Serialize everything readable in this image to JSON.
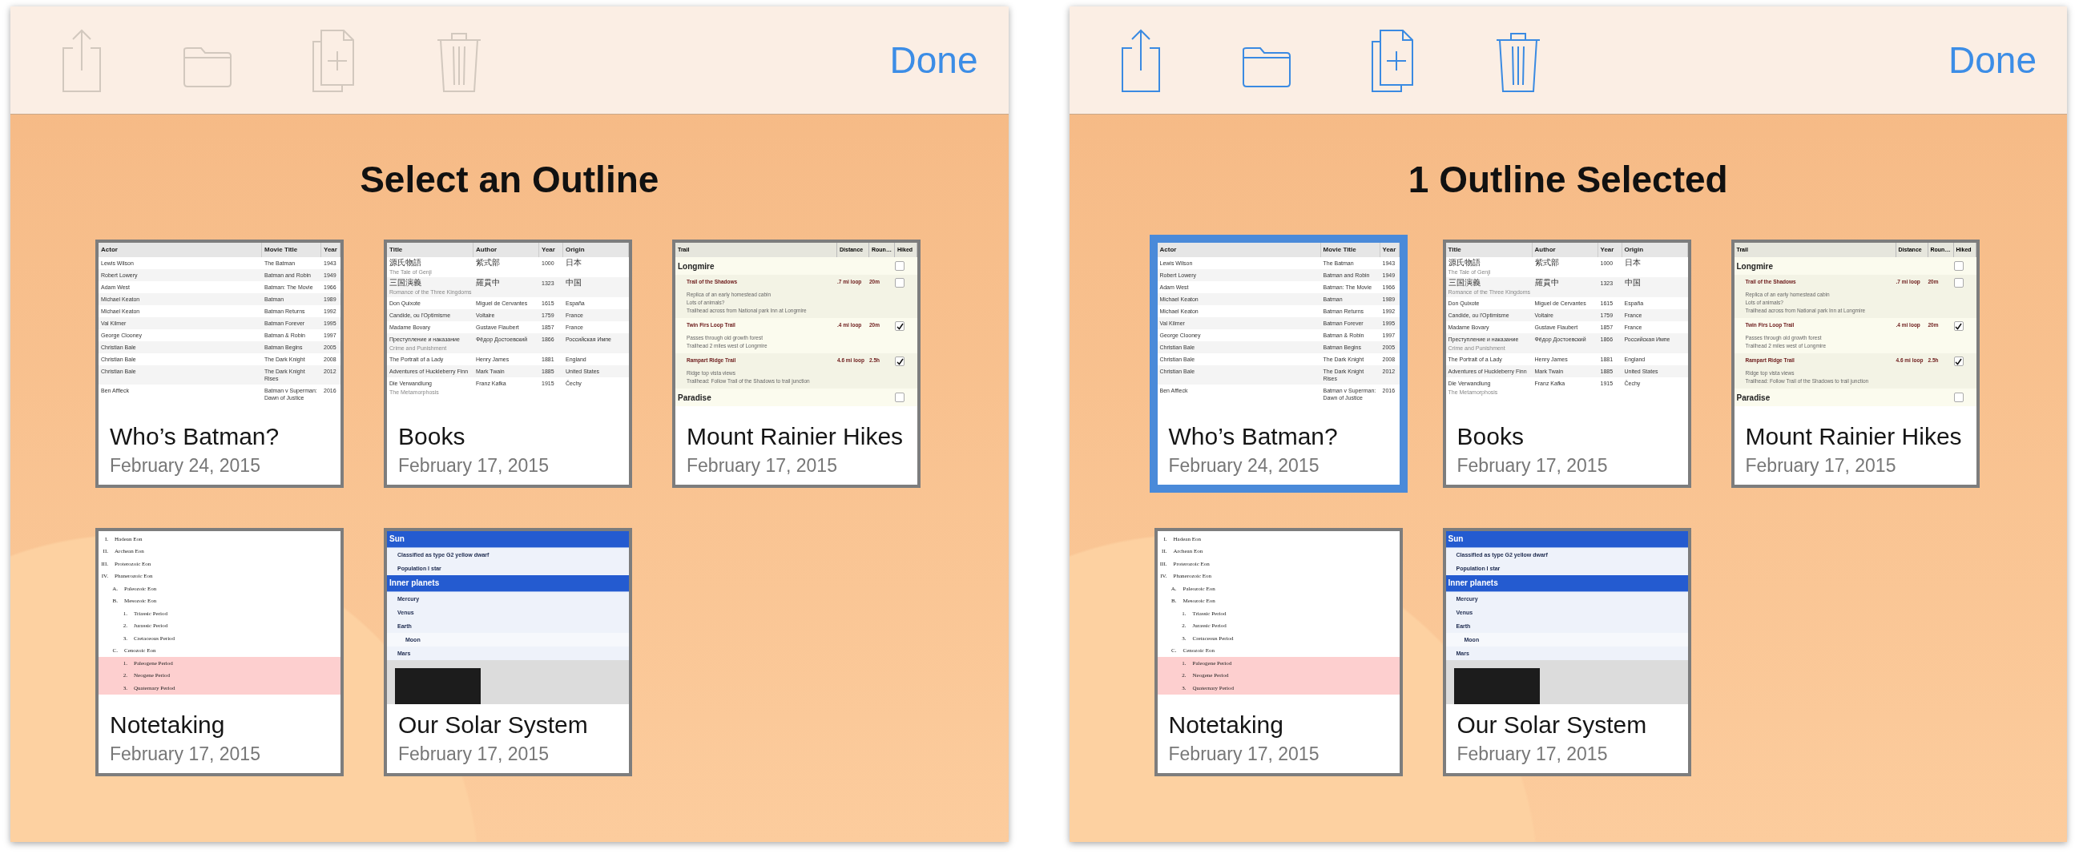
{
  "panels": [
    {
      "toolbar": {
        "disabled": true,
        "done": "Done"
      },
      "title": "Select an Outline",
      "outlines": [
        {
          "name": "Who’s Batman?",
          "date": "February 24, 2015",
          "selected": false,
          "preview": {
            "kind": "table",
            "columns": [
              "Actor",
              "Movie Title",
              "Year"
            ],
            "rows": [
              {
                "cells": [
                  "Lewis Wilson",
                  "The Batman",
                  "1943"
                ]
              },
              {
                "cells": [
                  "Robert Lowery",
                  "Batman and Robin",
                  "1949"
                ]
              },
              {
                "cells": [
                  "Adam West",
                  "Batman: The Movie",
                  "1966"
                ]
              },
              {
                "cells": [
                  "Michael Keaton",
                  "Batman",
                  "1989"
                ]
              },
              {
                "cells": [
                  "Michael Keaton",
                  "Batman Returns",
                  "1992"
                ]
              },
              {
                "cells": [
                  "Val Kilmer",
                  "Batman Forever",
                  "1995"
                ]
              },
              {
                "cells": [
                  "George Clooney",
                  "Batman & Robin",
                  "1997"
                ]
              },
              {
                "cells": [
                  "Christian Bale",
                  "Batman Begins",
                  "2005"
                ]
              },
              {
                "cells": [
                  "Christian Bale",
                  "The Dark Knight",
                  "2008"
                ]
              },
              {
                "cells": [
                  "Christian Bale",
                  "The Dark Knight Rises",
                  "2012"
                ]
              },
              {
                "cells": [
                  "Ben Affleck",
                  "Batman v Superman: Dawn of Justice",
                  "2016"
                ]
              }
            ]
          }
        },
        {
          "name": "Books",
          "date": "February 17, 2015",
          "selected": false,
          "preview": {
            "kind": "table",
            "columns": [
              "Title",
              "Author",
              "Year",
              "Origin"
            ],
            "rows": [
              {
                "cells": [
                  "源氏物語",
                  "紫式部",
                  "1000",
                  "日本"
                ],
                "note": "The Tale of Genji"
              },
              {
                "cells": [
                  "三国演義",
                  "羅貫中",
                  "1323",
                  "中国"
                ],
                "note": "Romance of the Three Kingdoms"
              },
              {
                "cells": [
                  "Don Quixote",
                  "Miguel de Cervantes",
                  "1615",
                  "España"
                ]
              },
              {
                "cells": [
                  "Candide, ou l'Optimisme",
                  "Voltaire",
                  "1759",
                  "France"
                ]
              },
              {
                "cells": [
                  "Madame Bovary",
                  "Gustave Flaubert",
                  "1857",
                  "France"
                ]
              },
              {
                "cells": [
                  "Преступление и наказание",
                  "Фёдор Достоевский",
                  "1866",
                  "Российская Импе"
                ],
                "note": "Crime and Punishment"
              },
              {
                "cells": [
                  "The Portrait of a Lady",
                  "Henry James",
                  "1881",
                  "England"
                ]
              },
              {
                "cells": [
                  "Adventures of Huckleberry Finn",
                  "Mark Twain",
                  "1885",
                  "United States"
                ]
              },
              {
                "cells": [
                  "Die Verwandlung",
                  "Franz Kafka",
                  "1915",
                  "Čechy"
                ],
                "note": "The Metamorphosis"
              }
            ]
          }
        },
        {
          "name": "Mount Rainier Hikes",
          "date": "February 17, 2015",
          "selected": false,
          "preview": {
            "kind": "trails",
            "columns": [
              "Trail",
              "Distance",
              "Roun…",
              "Hiked"
            ],
            "groups": [
              {
                "name": "Longmire",
                "checked": false,
                "trails": [
                  {
                    "name": "Trail of the Shadows",
                    "distance": ".7 mi loop",
                    "time": "20m",
                    "checked": false,
                    "notes": [
                      "Replica of an early homestead cabin",
                      "Lots of animals?",
                      "Trailhead across from National park Inn at Longmire"
                    ]
                  },
                  {
                    "name": "Twin Firs Loop Trail",
                    "distance": ".4 mi loop",
                    "time": "20m",
                    "checked": true,
                    "notes": [
                      "Passes through old growth forest",
                      "Trailhead 2 miles west of Longmire"
                    ]
                  },
                  {
                    "name": "Rampart Ridge Trail",
                    "distance": "4.6 mi loop",
                    "time": "2.5h",
                    "checked": true,
                    "notes": [
                      "Ridge top vista views",
                      "Trailhead: Follow Trail of the Shadows to trail junction"
                    ]
                  }
                ]
              },
              {
                "name": "Paradise",
                "checked": false
              }
            ]
          }
        },
        {
          "name": "Notetaking",
          "date": "February 17, 2015",
          "selected": false,
          "preview": {
            "kind": "outline",
            "items": [
              {
                "marker": "I.",
                "text": "Hadean Eon",
                "highlighted": false
              },
              {
                "marker": "II.",
                "text": "Archean Eon",
                "highlighted": false
              },
              {
                "marker": "III.",
                "text": "Proterozoic Eon",
                "highlighted": false
              },
              {
                "marker": "IV.",
                "text": "Phanerozoic Eon",
                "highlighted": false,
                "children": [
                  {
                    "marker": "A.",
                    "text": "Paleozoic Eon",
                    "highlighted": false
                  },
                  {
                    "marker": "B.",
                    "text": "Mesozoic Eon",
                    "highlighted": false,
                    "children": [
                      {
                        "marker": "1.",
                        "text": "Triassic Period",
                        "highlighted": false
                      },
                      {
                        "marker": "2.",
                        "text": "Jurassic Period",
                        "highlighted": false
                      },
                      {
                        "marker": "3.",
                        "text": "Cretaceous Period",
                        "highlighted": false
                      }
                    ]
                  },
                  {
                    "marker": "C.",
                    "text": "Cenozoic Eon",
                    "highlighted": false,
                    "children": [
                      {
                        "marker": "1.",
                        "text": "Paleogene Period",
                        "highlighted": true
                      },
                      {
                        "marker": "2.",
                        "text": "Neogene Period",
                        "highlighted": true
                      },
                      {
                        "marker": "3.",
                        "text": "Quaternary Period",
                        "highlighted": true
                      }
                    ]
                  }
                ]
              }
            ]
          }
        },
        {
          "name": "Our Solar System",
          "date": "February 17, 2015",
          "selected": false,
          "preview": {
            "kind": "solar",
            "rows": [
              {
                "kind": "heading",
                "text": "Sun"
              },
              {
                "kind": "item",
                "text": "Classified as type G2 yellow dwarf"
              },
              {
                "kind": "item",
                "text": "Population I star"
              },
              {
                "kind": "heading",
                "text": "Inner planets"
              },
              {
                "kind": "item",
                "text": "Mercury"
              },
              {
                "kind": "item",
                "text": "Venus"
              },
              {
                "kind": "item",
                "text": "Earth"
              },
              {
                "kind": "subitem",
                "text": "Moon"
              },
              {
                "kind": "item",
                "text": "Mars"
              },
              {
                "kind": "photo"
              }
            ]
          }
        }
      ]
    },
    {
      "toolbar": {
        "disabled": false,
        "done": "Done"
      },
      "title": "1 Outline Selected",
      "outlines": [
        {
          "name": "Who’s Batman?",
          "date": "February 24, 2015",
          "selected": true,
          "preview": {
            "kind": "table",
            "columns": [
              "Actor",
              "Movie Title",
              "Year"
            ],
            "rows": [
              {
                "cells": [
                  "Lewis Wilson",
                  "The Batman",
                  "1943"
                ]
              },
              {
                "cells": [
                  "Robert Lowery",
                  "Batman and Robin",
                  "1949"
                ]
              },
              {
                "cells": [
                  "Adam West",
                  "Batman: The Movie",
                  "1966"
                ]
              },
              {
                "cells": [
                  "Michael Keaton",
                  "Batman",
                  "1989"
                ]
              },
              {
                "cells": [
                  "Michael Keaton",
                  "Batman Returns",
                  "1992"
                ]
              },
              {
                "cells": [
                  "Val Kilmer",
                  "Batman Forever",
                  "1995"
                ]
              },
              {
                "cells": [
                  "George Clooney",
                  "Batman & Robin",
                  "1997"
                ]
              },
              {
                "cells": [
                  "Christian Bale",
                  "Batman Begins",
                  "2005"
                ]
              },
              {
                "cells": [
                  "Christian Bale",
                  "The Dark Knight",
                  "2008"
                ]
              },
              {
                "cells": [
                  "Christian Bale",
                  "The Dark Knight Rises",
                  "2012"
                ]
              },
              {
                "cells": [
                  "Ben Affleck",
                  "Batman v Superman: Dawn of Justice",
                  "2016"
                ]
              }
            ]
          }
        },
        {
          "name": "Books",
          "date": "February 17, 2015",
          "selected": false,
          "preview": {
            "kind": "table",
            "columns": [
              "Title",
              "Author",
              "Year",
              "Origin"
            ],
            "rows": [
              {
                "cells": [
                  "源氏物語",
                  "紫式部",
                  "1000",
                  "日本"
                ],
                "note": "The Tale of Genji"
              },
              {
                "cells": [
                  "三国演義",
                  "羅貫中",
                  "1323",
                  "中国"
                ],
                "note": "Romance of the Three Kingdoms"
              },
              {
                "cells": [
                  "Don Quixote",
                  "Miguel de Cervantes",
                  "1615",
                  "España"
                ]
              },
              {
                "cells": [
                  "Candide, ou l'Optimisme",
                  "Voltaire",
                  "1759",
                  "France"
                ]
              },
              {
                "cells": [
                  "Madame Bovary",
                  "Gustave Flaubert",
                  "1857",
                  "France"
                ]
              },
              {
                "cells": [
                  "Преступление и наказание",
                  "Фёдор Достоевский",
                  "1866",
                  "Российская Импе"
                ],
                "note": "Crime and Punishment"
              },
              {
                "cells": [
                  "The Portrait of a Lady",
                  "Henry James",
                  "1881",
                  "England"
                ]
              },
              {
                "cells": [
                  "Adventures of Huckleberry Finn",
                  "Mark Twain",
                  "1885",
                  "United States"
                ]
              },
              {
                "cells": [
                  "Die Verwandlung",
                  "Franz Kafka",
                  "1915",
                  "Čechy"
                ],
                "note": "The Metamorphosis"
              }
            ]
          }
        },
        {
          "name": "Mount Rainier Hikes",
          "date": "February 17, 2015",
          "selected": false,
          "preview": {
            "kind": "trails",
            "columns": [
              "Trail",
              "Distance",
              "Roun…",
              "Hiked"
            ],
            "groups": [
              {
                "name": "Longmire",
                "checked": false,
                "trails": [
                  {
                    "name": "Trail of the Shadows",
                    "distance": ".7 mi loop",
                    "time": "20m",
                    "checked": false,
                    "notes": [
                      "Replica of an early homestead cabin",
                      "Lots of animals?",
                      "Trailhead across from National park Inn at Longmire"
                    ]
                  },
                  {
                    "name": "Twin Firs Loop Trail",
                    "distance": ".4 mi loop",
                    "time": "20m",
                    "checked": true,
                    "notes": [
                      "Passes through old growth forest",
                      "Trailhead 2 miles west of Longmire"
                    ]
                  },
                  {
                    "name": "Rampart Ridge Trail",
                    "distance": "4.6 mi loop",
                    "time": "2.5h",
                    "checked": true,
                    "notes": [
                      "Ridge top vista views",
                      "Trailhead: Follow Trail of the Shadows to trail junction"
                    ]
                  }
                ]
              },
              {
                "name": "Paradise",
                "checked": false
              }
            ]
          }
        },
        {
          "name": "Notetaking",
          "date": "February 17, 2015",
          "selected": false,
          "preview": {
            "kind": "outline",
            "items": [
              {
                "marker": "I.",
                "text": "Hadean Eon",
                "highlighted": false
              },
              {
                "marker": "II.",
                "text": "Archean Eon",
                "highlighted": false
              },
              {
                "marker": "III.",
                "text": "Proterozoic Eon",
                "highlighted": false
              },
              {
                "marker": "IV.",
                "text": "Phanerozoic Eon",
                "highlighted": false,
                "children": [
                  {
                    "marker": "A.",
                    "text": "Paleozoic Eon",
                    "highlighted": false
                  },
                  {
                    "marker": "B.",
                    "text": "Mesozoic Eon",
                    "highlighted": false,
                    "children": [
                      {
                        "marker": "1.",
                        "text": "Triassic Period",
                        "highlighted": false
                      },
                      {
                        "marker": "2.",
                        "text": "Jurassic Period",
                        "highlighted": false
                      },
                      {
                        "marker": "3.",
                        "text": "Cretaceous Period",
                        "highlighted": false
                      }
                    ]
                  },
                  {
                    "marker": "C.",
                    "text": "Cenozoic Eon",
                    "highlighted": false,
                    "children": [
                      {
                        "marker": "1.",
                        "text": "Paleogene Period",
                        "highlighted": true
                      },
                      {
                        "marker": "2.",
                        "text": "Neogene Period",
                        "highlighted": true
                      },
                      {
                        "marker": "3.",
                        "text": "Quaternary Period",
                        "highlighted": true
                      }
                    ]
                  }
                ]
              }
            ]
          }
        },
        {
          "name": "Our Solar System",
          "date": "February 17, 2015",
          "selected": false,
          "preview": {
            "kind": "solar",
            "rows": [
              {
                "kind": "heading",
                "text": "Sun"
              },
              {
                "kind": "item",
                "text": "Classified as type G2 yellow dwarf"
              },
              {
                "kind": "item",
                "text": "Population I star"
              },
              {
                "kind": "heading",
                "text": "Inner planets"
              },
              {
                "kind": "item",
                "text": "Mercury"
              },
              {
                "kind": "item",
                "text": "Venus"
              },
              {
                "kind": "item",
                "text": "Earth"
              },
              {
                "kind": "subitem",
                "text": "Moon"
              },
              {
                "kind": "item",
                "text": "Mars"
              },
              {
                "kind": "photo"
              }
            ]
          }
        }
      ]
    }
  ]
}
